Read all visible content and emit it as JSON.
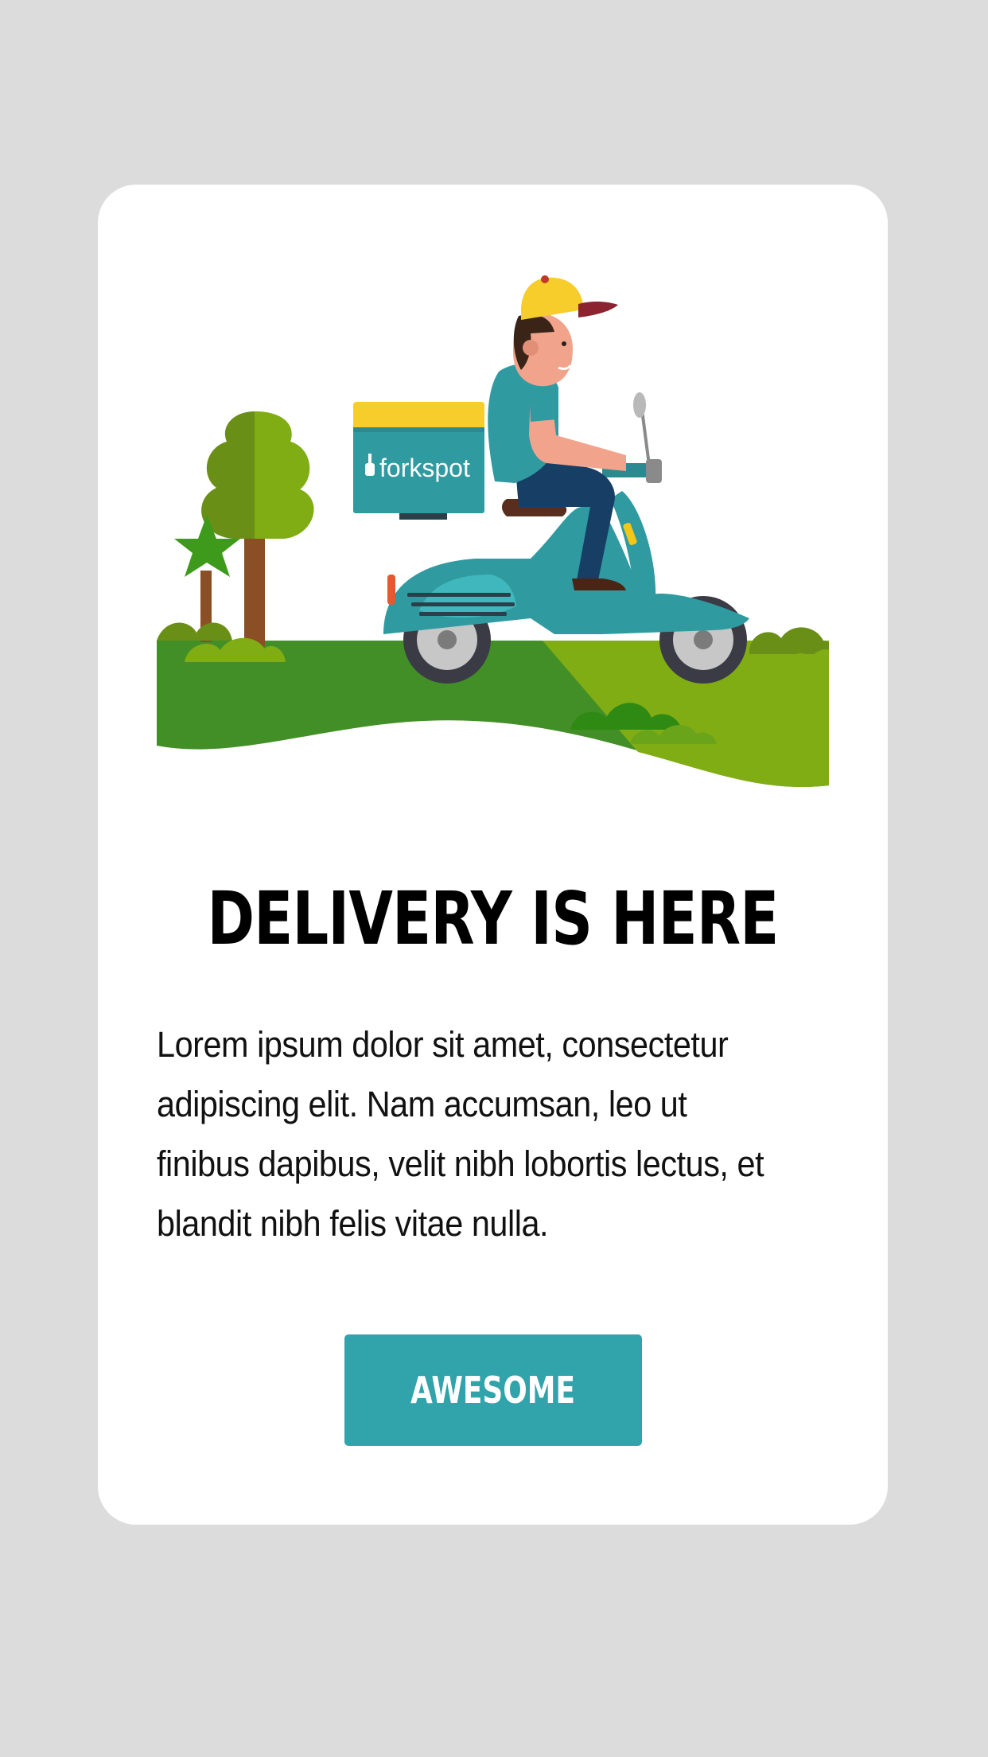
{
  "dialog": {
    "illustration": {
      "name": "delivery-scooter-illustration",
      "box_brand": "forkspot"
    },
    "title": "DELIVERY IS HERE",
    "body": "Lorem ipsum dolor sit amet, consectetur adipiscing elit. Nam accumsan, leo ut finibus dapibus, velit nibh lobortis lectus, et blandit nibh felis vitae nulla.",
    "button_label": "AWESOME"
  },
  "colors": {
    "background": "#dcdcdc",
    "card": "#ffffff",
    "accent": "#31a3aa",
    "dark_green": "#438f27",
    "light_green": "#80ad14"
  }
}
